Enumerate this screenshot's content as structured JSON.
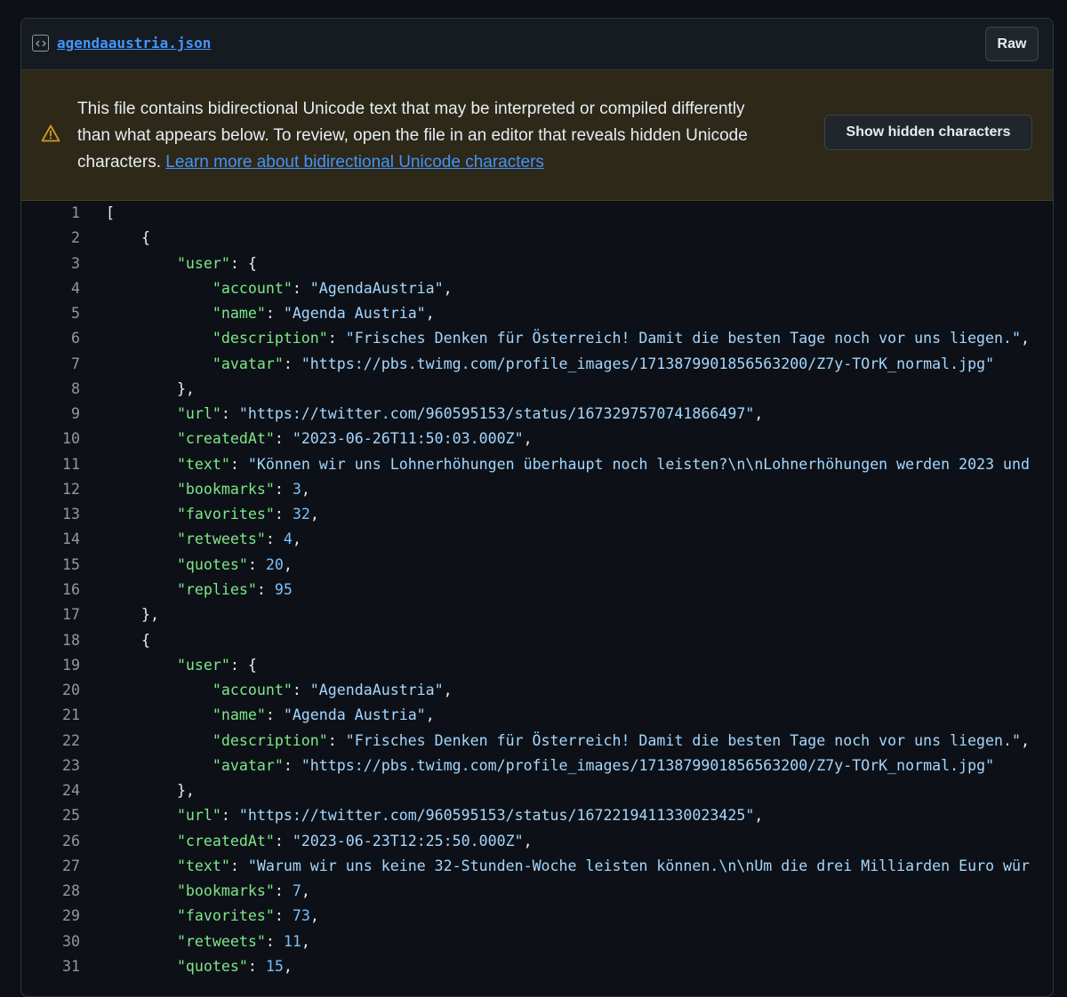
{
  "file": {
    "name": "agendaaustria.json",
    "raw_label": "Raw"
  },
  "warning": {
    "text": "This file contains bidirectional Unicode text that may be interpreted or compiled differently than what appears below. To review, open the file in an editor that reveals hidden Unicode characters. ",
    "link_text": "Learn more about bidirectional Unicode characters",
    "button_label": "Show hidden characters"
  },
  "colors": {
    "key": "#7ee787",
    "string": "#a5d6ff",
    "number": "#79c0ff",
    "link": "#4493f8",
    "warning_bg": "#2d2818",
    "background": "#0d1117"
  },
  "code_lines": [
    {
      "n": "1",
      "indent": 0,
      "t": [
        [
          "p",
          "["
        ]
      ]
    },
    {
      "n": "2",
      "indent": 1,
      "t": [
        [
          "p",
          "{"
        ]
      ]
    },
    {
      "n": "3",
      "indent": 2,
      "t": [
        [
          "k",
          "\"user\""
        ],
        [
          "p",
          ": {"
        ]
      ]
    },
    {
      "n": "4",
      "indent": 3,
      "t": [
        [
          "k",
          "\"account\""
        ],
        [
          "p",
          ": "
        ],
        [
          "s",
          "\"AgendaAustria\""
        ],
        [
          "p",
          ","
        ]
      ]
    },
    {
      "n": "5",
      "indent": 3,
      "t": [
        [
          "k",
          "\"name\""
        ],
        [
          "p",
          ": "
        ],
        [
          "s",
          "\"Agenda Austria\""
        ],
        [
          "p",
          ","
        ]
      ]
    },
    {
      "n": "6",
      "indent": 3,
      "t": [
        [
          "k",
          "\"description\""
        ],
        [
          "p",
          ": "
        ],
        [
          "s",
          "\"Frisches Denken für Österreich! Damit die besten Tage noch vor uns liegen.\""
        ],
        [
          "p",
          ","
        ]
      ]
    },
    {
      "n": "7",
      "indent": 3,
      "t": [
        [
          "k",
          "\"avatar\""
        ],
        [
          "p",
          ": "
        ],
        [
          "s",
          "\"https://pbs.twimg.com/profile_images/1713879901856563200/Z7y-TOrK_normal.jpg\""
        ]
      ]
    },
    {
      "n": "8",
      "indent": 2,
      "t": [
        [
          "p",
          "},"
        ]
      ]
    },
    {
      "n": "9",
      "indent": 2,
      "t": [
        [
          "k",
          "\"url\""
        ],
        [
          "p",
          ": "
        ],
        [
          "s",
          "\"https://twitter.com/960595153/status/1673297570741866497\""
        ],
        [
          "p",
          ","
        ]
      ]
    },
    {
      "n": "10",
      "indent": 2,
      "t": [
        [
          "k",
          "\"createdAt\""
        ],
        [
          "p",
          ": "
        ],
        [
          "s",
          "\"2023-06-26T11:50:03.000Z\""
        ],
        [
          "p",
          ","
        ]
      ]
    },
    {
      "n": "11",
      "indent": 2,
      "t": [
        [
          "k",
          "\"text\""
        ],
        [
          "p",
          ": "
        ],
        [
          "s",
          "\"Können wir uns Lohnerhöhungen überhaupt noch leisten?\\n\\nLohnerhöhungen werden 2023 und"
        ]
      ]
    },
    {
      "n": "12",
      "indent": 2,
      "t": [
        [
          "k",
          "\"bookmarks\""
        ],
        [
          "p",
          ": "
        ],
        [
          "n",
          "3"
        ],
        [
          "p",
          ","
        ]
      ]
    },
    {
      "n": "13",
      "indent": 2,
      "t": [
        [
          "k",
          "\"favorites\""
        ],
        [
          "p",
          ": "
        ],
        [
          "n",
          "32"
        ],
        [
          "p",
          ","
        ]
      ]
    },
    {
      "n": "14",
      "indent": 2,
      "t": [
        [
          "k",
          "\"retweets\""
        ],
        [
          "p",
          ": "
        ],
        [
          "n",
          "4"
        ],
        [
          "p",
          ","
        ]
      ]
    },
    {
      "n": "15",
      "indent": 2,
      "t": [
        [
          "k",
          "\"quotes\""
        ],
        [
          "p",
          ": "
        ],
        [
          "n",
          "20"
        ],
        [
          "p",
          ","
        ]
      ]
    },
    {
      "n": "16",
      "indent": 2,
      "t": [
        [
          "k",
          "\"replies\""
        ],
        [
          "p",
          ": "
        ],
        [
          "n",
          "95"
        ]
      ]
    },
    {
      "n": "17",
      "indent": 1,
      "t": [
        [
          "p",
          "},"
        ]
      ]
    },
    {
      "n": "18",
      "indent": 1,
      "t": [
        [
          "p",
          "{"
        ]
      ]
    },
    {
      "n": "19",
      "indent": 2,
      "t": [
        [
          "k",
          "\"user\""
        ],
        [
          "p",
          ": {"
        ]
      ]
    },
    {
      "n": "20",
      "indent": 3,
      "t": [
        [
          "k",
          "\"account\""
        ],
        [
          "p",
          ": "
        ],
        [
          "s",
          "\"AgendaAustria\""
        ],
        [
          "p",
          ","
        ]
      ]
    },
    {
      "n": "21",
      "indent": 3,
      "t": [
        [
          "k",
          "\"name\""
        ],
        [
          "p",
          ": "
        ],
        [
          "s",
          "\"Agenda Austria\""
        ],
        [
          "p",
          ","
        ]
      ]
    },
    {
      "n": "22",
      "indent": 3,
      "t": [
        [
          "k",
          "\"description\""
        ],
        [
          "p",
          ": "
        ],
        [
          "s",
          "\"Frisches Denken für Österreich! Damit die besten Tage noch vor uns liegen.\""
        ],
        [
          "p",
          ","
        ]
      ]
    },
    {
      "n": "23",
      "indent": 3,
      "t": [
        [
          "k",
          "\"avatar\""
        ],
        [
          "p",
          ": "
        ],
        [
          "s",
          "\"https://pbs.twimg.com/profile_images/1713879901856563200/Z7y-TOrK_normal.jpg\""
        ]
      ]
    },
    {
      "n": "24",
      "indent": 2,
      "t": [
        [
          "p",
          "},"
        ]
      ]
    },
    {
      "n": "25",
      "indent": 2,
      "t": [
        [
          "k",
          "\"url\""
        ],
        [
          "p",
          ": "
        ],
        [
          "s",
          "\"https://twitter.com/960595153/status/1672219411330023425\""
        ],
        [
          "p",
          ","
        ]
      ]
    },
    {
      "n": "26",
      "indent": 2,
      "t": [
        [
          "k",
          "\"createdAt\""
        ],
        [
          "p",
          ": "
        ],
        [
          "s",
          "\"2023-06-23T12:25:50.000Z\""
        ],
        [
          "p",
          ","
        ]
      ]
    },
    {
      "n": "27",
      "indent": 2,
      "t": [
        [
          "k",
          "\"text\""
        ],
        [
          "p",
          ": "
        ],
        [
          "s",
          "\"Warum wir uns keine 32-Stunden-Woche leisten können.\\n\\nUm die drei Milliarden Euro wür"
        ]
      ]
    },
    {
      "n": "28",
      "indent": 2,
      "t": [
        [
          "k",
          "\"bookmarks\""
        ],
        [
          "p",
          ": "
        ],
        [
          "n",
          "7"
        ],
        [
          "p",
          ","
        ]
      ]
    },
    {
      "n": "29",
      "indent": 2,
      "t": [
        [
          "k",
          "\"favorites\""
        ],
        [
          "p",
          ": "
        ],
        [
          "n",
          "73"
        ],
        [
          "p",
          ","
        ]
      ]
    },
    {
      "n": "30",
      "indent": 2,
      "t": [
        [
          "k",
          "\"retweets\""
        ],
        [
          "p",
          ": "
        ],
        [
          "n",
          "11"
        ],
        [
          "p",
          ","
        ]
      ]
    },
    {
      "n": "31",
      "indent": 2,
      "t": [
        [
          "k",
          "\"quotes\""
        ],
        [
          "p",
          ": "
        ],
        [
          "n",
          "15"
        ],
        [
          "p",
          ","
        ]
      ]
    }
  ]
}
